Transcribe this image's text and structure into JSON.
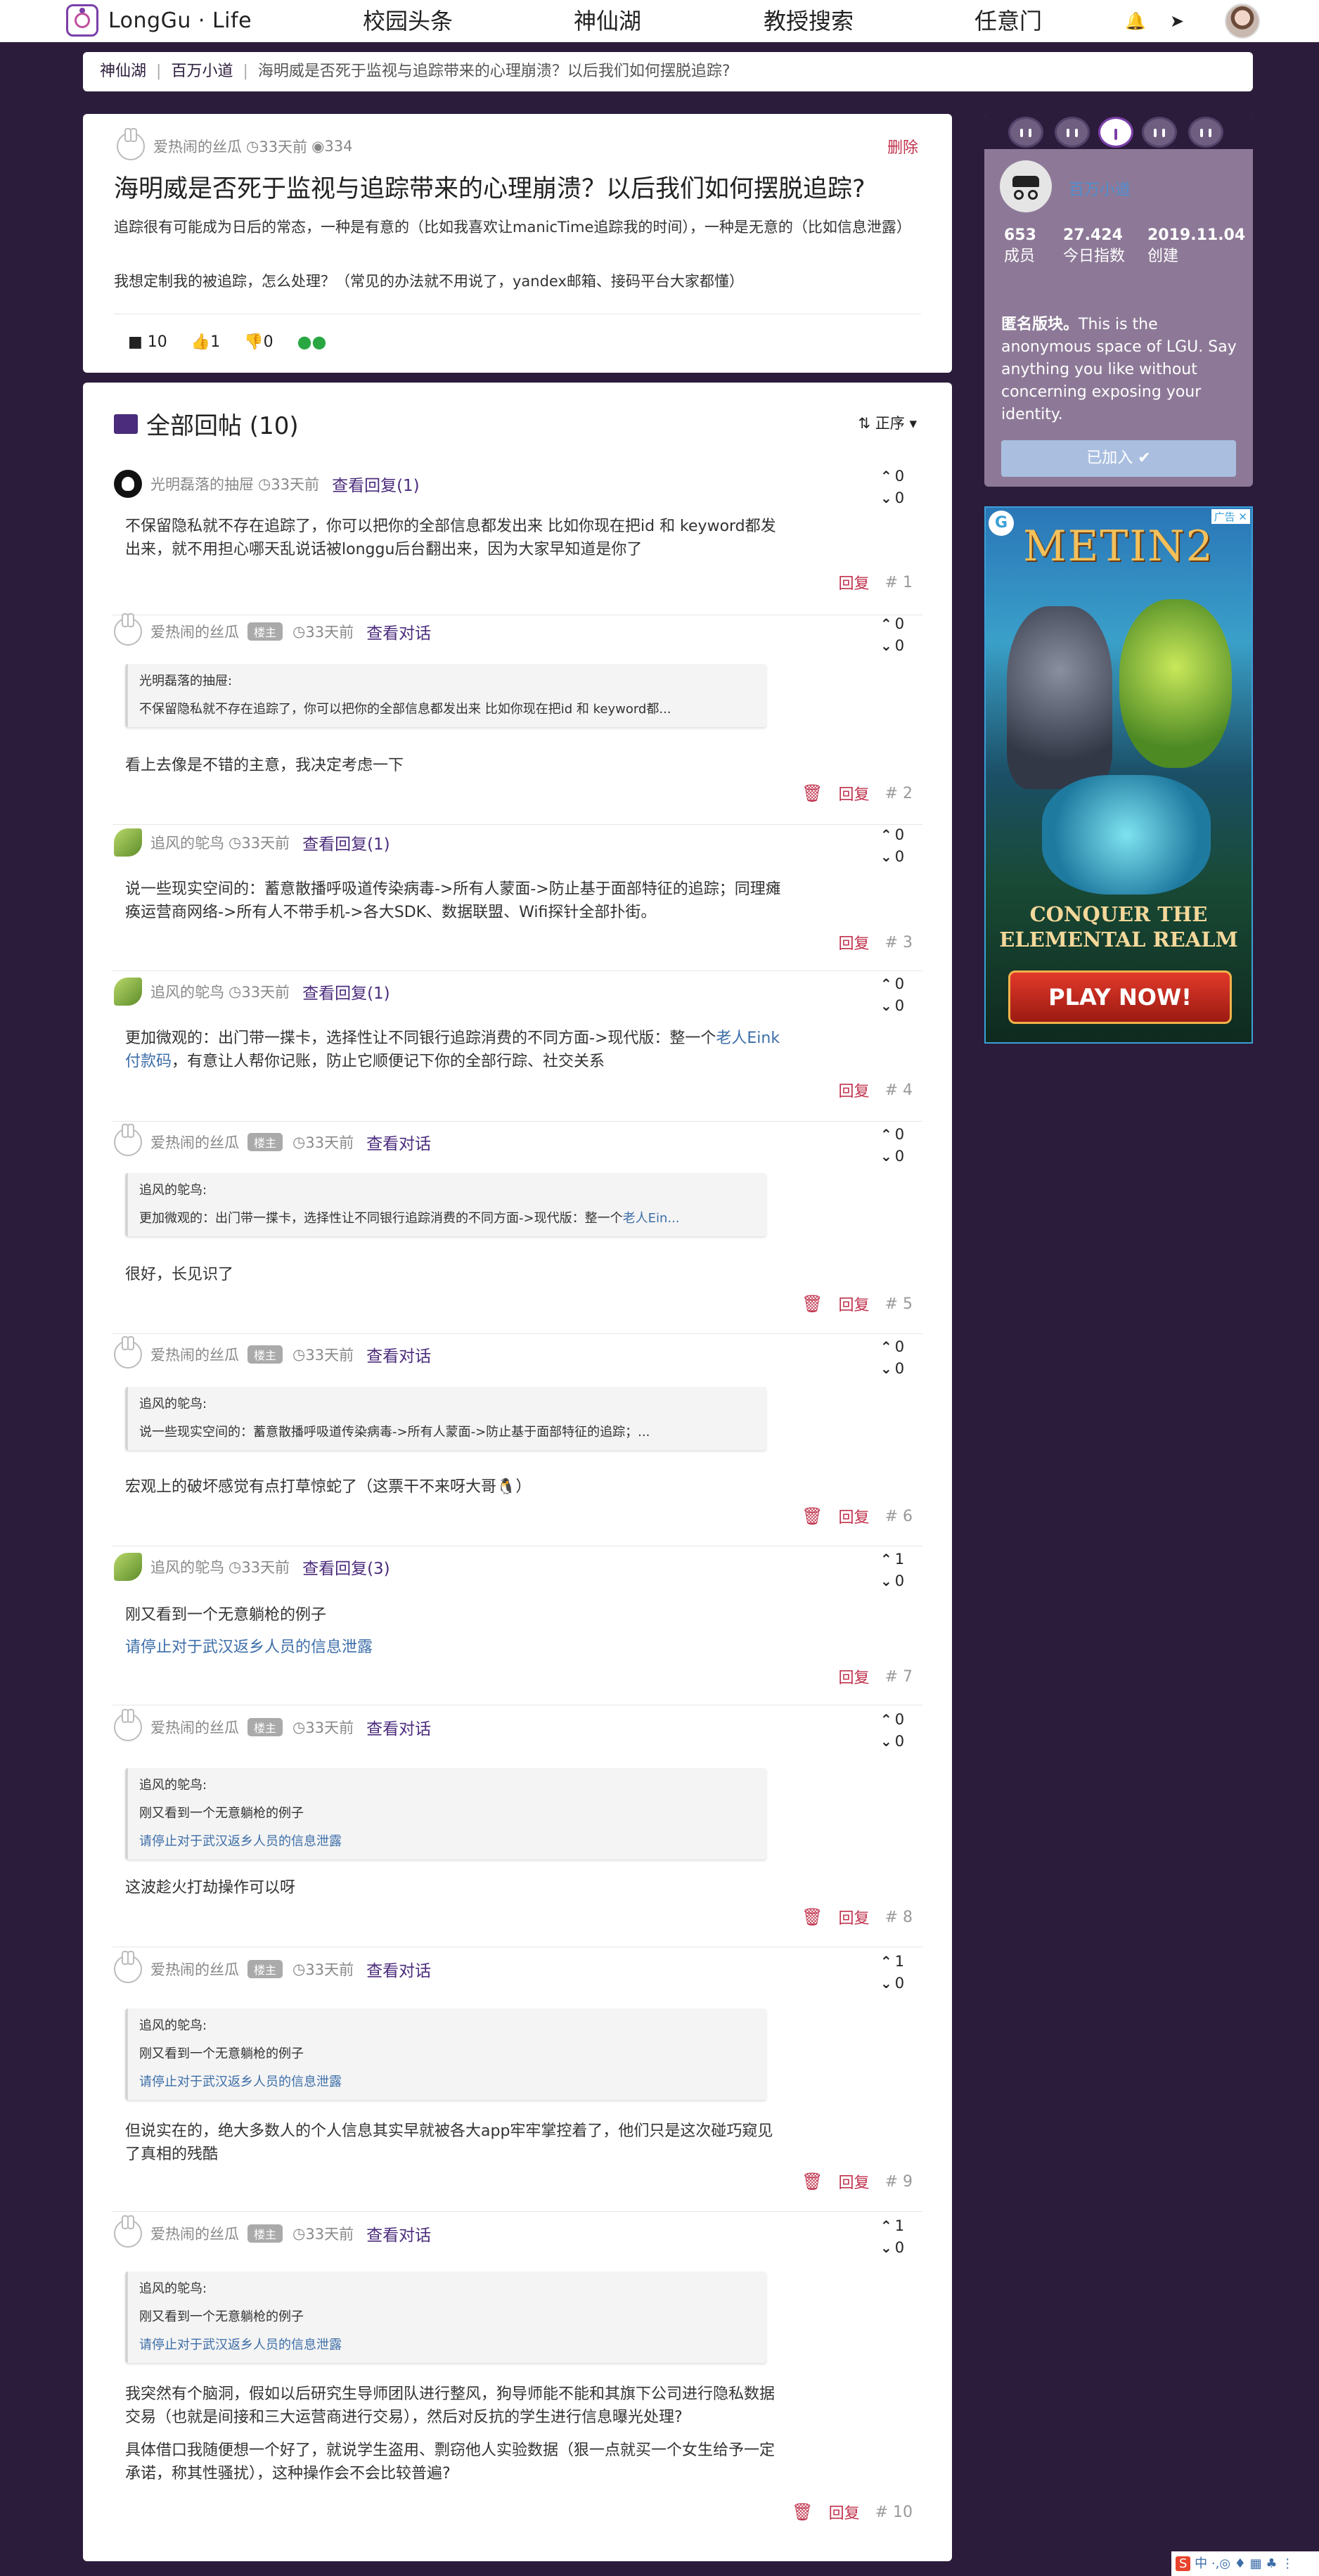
{
  "app": {
    "logo_text": "LongGu · Life",
    "nav": [
      "校园头条",
      "神仙湖",
      "教授搜索",
      "任意门"
    ]
  },
  "breadcrumb": [
    "神仙湖",
    "百万小道",
    "海明威是否死于监视与追踪带来的心理崩溃？以后我们如何摆脱追踪?"
  ],
  "post": {
    "author": "爱热闹的丝瓜",
    "time": "33天前",
    "views": "334",
    "delete_label": "删除",
    "title": "海明威是否死于监视与追踪带来的心理崩溃？以后我们如何摆脱追踪?",
    "body1": "追踪很有可能成为日后的常态，一种是有意的（比如我喜欢让manicTime追踪我的时间），一种是无意的（比如信息泄露）",
    "body2": "我想定制我的被追踪，怎么处理？（常见的办法就不用说了，yandex邮箱、接码平台大家都懂）",
    "comments": "10",
    "likes": "1",
    "dislikes": "0"
  },
  "replies_header": {
    "title": "全部回帖 (10)",
    "sort_label": "正序"
  },
  "replies": [
    {
      "author": "光明磊落的抽屉",
      "badge": "",
      "time": "33天前",
      "link": "查看回复(1)",
      "quote": null,
      "text": "不保留隐私就不存在追踪了，你可以把你的全部信息都发出来 比如你现在把id 和 keyword都发出来，就不用担心哪天乱说话被longgu后台翻出来，因为大家早知道是你了",
      "text_link": "",
      "up": "0",
      "down": "0",
      "num": "# 1",
      "del": false
    },
    {
      "author": "爱热闹的丝瓜",
      "badge": "楼主",
      "time": "33天前",
      "link": "查看对话",
      "quote": {
        "who": "光明磊落的抽屉:",
        "line": "不保留隐私就不存在追踪了，你可以把你的全部信息都发出来 比如你现在把id 和 keyword都...",
        "line_link": "",
        "extra": ""
      },
      "text": "看上去像是不错的主意，我决定考虑一下",
      "text_link": "",
      "up": "0",
      "down": "0",
      "num": "# 2",
      "del": true
    },
    {
      "author": "追风的鸵鸟",
      "badge": "",
      "time": "33天前",
      "link": "查看回复(1)",
      "quote": null,
      "text": "说一些现实空间的：蓄意散播呼吸道传染病毒->所有人蒙面->防止基于面部特征的追踪；同理瘫痪运营商网络->所有人不带手机->各大SDK、数据联盟、Wifi探针全部扑街。",
      "text_link": "",
      "up": "0",
      "down": "0",
      "num": "# 3",
      "del": false
    },
    {
      "author": "追风的鸵鸟",
      "badge": "",
      "time": "33天前",
      "link": "查看回复(1)",
      "quote": null,
      "text": "更加微观的：出门带一揲卡，选择性让不同银行追踪消费的不同方面->现代版：整一个",
      "text_link": "老人Eink付款码",
      "text_after": "，有意让人帮你记账，防止它顺便记下你的全部行踪、社交关系",
      "up": "0",
      "down": "0",
      "num": "# 4",
      "del": false
    },
    {
      "author": "爱热闹的丝瓜",
      "badge": "楼主",
      "time": "33天前",
      "link": "查看对话",
      "quote": {
        "who": "追风的鸵鸟:",
        "line": "更加微观的：出门带一揲卡，选择性让不同银行追踪消费的不同方面->现代版：整一个",
        "line_link": "老人Ein...",
        "extra": ""
      },
      "text": "很好，长见识了",
      "text_link": "",
      "up": "0",
      "down": "0",
      "num": "# 5",
      "del": true
    },
    {
      "author": "爱热闹的丝瓜",
      "badge": "楼主",
      "time": "33天前",
      "link": "查看对话",
      "quote": {
        "who": "追风的鸵鸟:",
        "line": "说一些现实空间的：蓄意散播呼吸道传染病毒->所有人蒙面->防止基于面部特征的追踪；...",
        "line_link": "",
        "extra": ""
      },
      "text": "宏观上的破坏感觉有点打草惊蛇了（这票干不来呀大哥🐧）",
      "text_link": "",
      "up": "0",
      "down": "0",
      "num": "# 6",
      "del": true
    },
    {
      "author": "追风的鸵鸟",
      "badge": "",
      "time": "33天前",
      "link": "查看回复(3)",
      "quote": null,
      "text": "刚又看到一个无意躺枪的例子",
      "text_link": "请停止对于武汉返乡人员的信息泄露",
      "up": "1",
      "down": "0",
      "num": "# 7",
      "del": false
    },
    {
      "author": "爱热闹的丝瓜",
      "badge": "楼主",
      "time": "33天前",
      "link": "查看对话",
      "quote": {
        "who": "追风的鸵鸟:",
        "line": "刚又看到一个无意躺枪的例子",
        "line_link": "",
        "extra": "请停止对于武汉返乡人员的信息泄露"
      },
      "text": "这波趁火打劫操作可以呀",
      "text_link": "",
      "up": "0",
      "down": "0",
      "num": "# 8",
      "del": true
    },
    {
      "author": "爱热闹的丝瓜",
      "badge": "楼主",
      "time": "33天前",
      "link": "查看对话",
      "quote": {
        "who": "追风的鸵鸟:",
        "line": "刚又看到一个无意躺枪的例子",
        "line_link": "",
        "extra": "请停止对于武汉返乡人员的信息泄露"
      },
      "text": "但说实在的，绝大多数人的个人信息其实早就被各大app牢牢掌控着了，他们只是这次碰巧窥见了真相的残酷",
      "text_link": "",
      "up": "1",
      "down": "0",
      "num": "# 9",
      "del": true
    },
    {
      "author": "爱热闹的丝瓜",
      "badge": "楼主",
      "time": "33天前",
      "link": "查看对话",
      "quote": {
        "who": "追风的鸵鸟:",
        "line": "刚又看到一个无意躺枪的例子",
        "line_link": "",
        "extra": "请停止对于武汉返乡人员的信息泄露"
      },
      "text": "我突然有个脑洞，假如以后研究生导师团队进行整风，狗导师能不能和其旗下公司进行隐私数据交易（也就是间接和三大运营商进行交易），然后对反抗的学生进行信息曝光处理?",
      "text2": "具体借口我随便想一个好了，就说学生盗用、剽窃他人实验数据（狠一点就买一个女生给予一定承诺，称其性骚扰），这种操作会不会比较普遍?",
      "text_link": "",
      "up": "1",
      "down": "0",
      "num": "# 10",
      "del": true
    }
  ],
  "sidebar": {
    "board_name": "百万小道",
    "members": "653",
    "members_label": "成员",
    "index": "27.424",
    "index_label": "今日指数",
    "created": "2019.11.04",
    "created_label": "创建",
    "desc_bold": "匿名版块。",
    "desc": "This is the anonymous space of LGU. Say anything you like without concerning exposing your identity.",
    "joined_label": "已加入 ✔"
  },
  "ad": {
    "label": "广告",
    "brand": "METIN2",
    "headline1": "CONQUER THE",
    "headline2": "ELEMENTAL REALM",
    "cta": "PLAY NOW!"
  },
  "colors": {
    "accent": "#4b2c7c",
    "danger": "#c0334d",
    "bg": "#2c1c3b",
    "link": "#3c6ea8"
  }
}
